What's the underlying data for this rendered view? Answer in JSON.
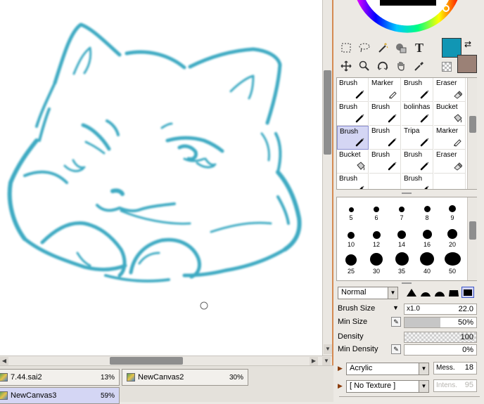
{
  "tabs": [
    {
      "name": "7.44.sai2",
      "percent": "13%",
      "active": false
    },
    {
      "name": "NewCanvas2",
      "percent": "30%",
      "active": false
    },
    {
      "name": "NewCanvas3",
      "percent": "59%",
      "active": true
    }
  ],
  "colors": {
    "foreground": "#1196b4",
    "background": "#9b8176",
    "stroke": "#1a9bb8",
    "accent_divider": "#d58a52"
  },
  "tools": [
    {
      "name": "rect-select-icon"
    },
    {
      "name": "lasso-icon"
    },
    {
      "name": "magic-wand-icon"
    },
    {
      "name": "color-picker-shape-icon"
    },
    {
      "name": "text-tool-icon",
      "glyph": "T"
    },
    {
      "name": "move-icon"
    },
    {
      "name": "zoom-icon"
    },
    {
      "name": "rotate-icon"
    },
    {
      "name": "hand-icon"
    },
    {
      "name": "eyedropper-icon"
    }
  ],
  "brushes": [
    {
      "label": "Brush",
      "icon": "brush-icon"
    },
    {
      "label": "Marker",
      "icon": "marker-icon"
    },
    {
      "label": "Brush",
      "icon": "brush-icon"
    },
    {
      "label": "Eraser",
      "icon": "eraser-icon"
    },
    {
      "label": "Brush",
      "icon": "brush-icon"
    },
    {
      "label": "Brush",
      "icon": "brush-icon"
    },
    {
      "label": "bolinhas",
      "icon": "brush-icon"
    },
    {
      "label": "Bucket",
      "icon": "bucket-icon"
    },
    {
      "label": "Brush",
      "icon": "brush-icon",
      "selected": true
    },
    {
      "label": "Brush",
      "icon": "brush-icon"
    },
    {
      "label": "Tripa",
      "icon": "brush-icon"
    },
    {
      "label": "Marker",
      "icon": "marker-icon"
    },
    {
      "label": "Bucket",
      "icon": "bucket-icon"
    },
    {
      "label": "Brush",
      "icon": "brush-icon"
    },
    {
      "label": "Brush",
      "icon": "brush-icon"
    },
    {
      "label": "Eraser",
      "icon": "eraser-icon"
    },
    {
      "label": "Brush",
      "icon": "brush-icon"
    },
    {
      "label": "",
      "icon": ""
    },
    {
      "label": "Brush",
      "icon": "brush-icon"
    },
    {
      "label": "",
      "icon": ""
    }
  ],
  "sizes": [
    "5",
    "6",
    "7",
    "8",
    "9",
    "10",
    "12",
    "14",
    "16",
    "20",
    "25",
    "30",
    "35",
    "40",
    "50"
  ],
  "blend_mode": "Normal",
  "brush_size": {
    "label": "Brush Size",
    "multiplier": "x1.0",
    "value": "22.0"
  },
  "min_size": {
    "label": "Min Size",
    "value": "50%",
    "fraction": 0.5
  },
  "density": {
    "label": "Density",
    "value": "100"
  },
  "min_density": {
    "label": "Min Density",
    "value": "0%"
  },
  "texture": {
    "name": "Acrylic",
    "mess_label": "Mess.",
    "mess_value": "18"
  },
  "no_texture": {
    "name": "[ No Texture ]",
    "intens_label": "Intens.",
    "intens_value": "95"
  }
}
